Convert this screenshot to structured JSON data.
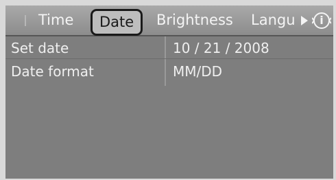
{
  "tabs": [
    {
      "label": "Time",
      "selected": false
    },
    {
      "label": "Date",
      "selected": true
    },
    {
      "label": "Brightness",
      "selected": false
    },
    {
      "label": "Langu",
      "selected": false
    }
  ],
  "nav": {
    "more_tabs_icon": "arrow-right-icon",
    "info_icon": "info-icon",
    "info_glyph": "i"
  },
  "settings": [
    {
      "label": "Set date",
      "value": "10 / 21 / 2008"
    },
    {
      "label": "Date format",
      "value": "MM/DD"
    }
  ],
  "colors": {
    "background": "#7e7e7e",
    "tabbar": "#9a9a9a",
    "text": "#efefef",
    "selected_tab_text": "#1a1a1a"
  }
}
